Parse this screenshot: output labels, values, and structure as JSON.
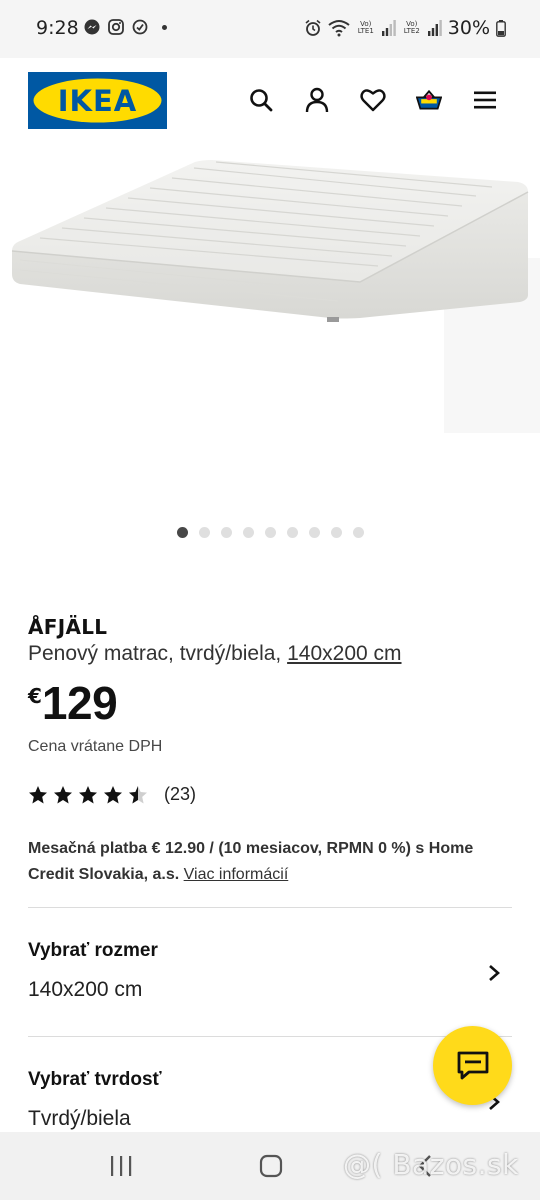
{
  "status_bar": {
    "time": "9:28",
    "lte1": "Vo) LTE1",
    "lte2": "Vo) LTE2",
    "battery": "30%"
  },
  "header": {
    "logo_text": "IKEA",
    "icons": [
      "search-icon",
      "account-icon",
      "heart-icon",
      "basket-icon",
      "menu-icon"
    ],
    "brand_blue": "#0058a3",
    "brand_yellow": "#ffdb00"
  },
  "carousel": {
    "total": 9,
    "active_index": 0
  },
  "product": {
    "name": "ÅFJÄLL",
    "description": "Penový matrac, tvrdý/biela, ",
    "size_link": "140x200 cm",
    "currency": "€",
    "price": "129",
    "vat_note": "Cena vrátane DPH",
    "rating_value": 4.5,
    "rating_count": "(23)"
  },
  "financing": {
    "text": "Mesačná platba € 12.90 / (10 mesiacov, RPMN 0 %) s Home Credit Slovakia, a.s. ",
    "link": "Viac informácií"
  },
  "options": [
    {
      "title": "Vybrať rozmer",
      "value": "140x200 cm"
    },
    {
      "title": "Vybrať tvrdosť",
      "value": "Tvrdý/biela"
    }
  ],
  "chat": {
    "icon": "chat-icon",
    "color": "#ffda1a"
  },
  "watermark": "@( Bazos.sk"
}
